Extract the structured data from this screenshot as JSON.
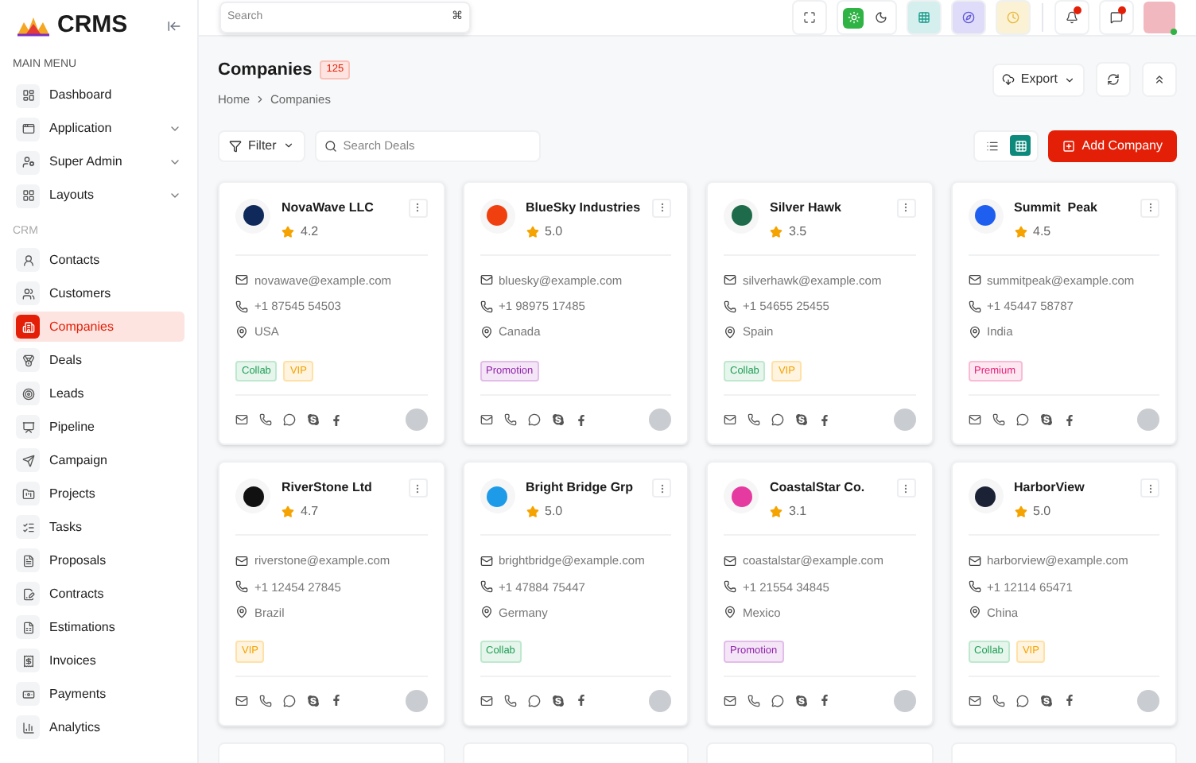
{
  "brand": {
    "name": "CRMS"
  },
  "sidebar": {
    "sections": [
      {
        "title": "MAIN MENU",
        "items": [
          {
            "label": "Dashboard",
            "selected": false
          },
          {
            "label": "Application",
            "selected": false,
            "expanded": false
          },
          {
            "label": "Super Admin",
            "selected": false,
            "expanded": false
          },
          {
            "label": "Layouts",
            "selected": false,
            "expanded": false
          }
        ]
      },
      {
        "title": "CRM",
        "items": [
          {
            "label": "Contacts",
            "selected": false
          },
          {
            "label": "Customers",
            "selected": false
          },
          {
            "label": "Companies",
            "selected": true
          },
          {
            "label": "Deals",
            "selected": false
          },
          {
            "label": "Leads",
            "selected": false
          },
          {
            "label": "Pipeline",
            "selected": false
          },
          {
            "label": "Campaign",
            "selected": false
          },
          {
            "label": "Projects",
            "selected": false
          },
          {
            "label": "Tasks",
            "selected": false
          },
          {
            "label": "Proposals",
            "selected": false
          },
          {
            "label": "Contracts",
            "selected": false
          },
          {
            "label": "Estimations",
            "selected": false
          },
          {
            "label": "Invoices",
            "selected": false
          },
          {
            "label": "Payments",
            "selected": false
          },
          {
            "label": "Analytics",
            "selected": false
          }
        ]
      }
    ]
  },
  "topbar": {
    "search": {
      "placeholder": "Search",
      "shortcut": "⌘"
    },
    "theme": [
      {
        "kind": "light",
        "selected": true
      },
      {
        "kind": "dark",
        "selected": false
      }
    ],
    "notifications": [
      {
        "kind": "bell",
        "unread": true
      },
      {
        "kind": "chat",
        "unread": true
      }
    ],
    "user": {
      "online": true
    }
  },
  "page": {
    "title": "Companies",
    "count": "125",
    "breadcrumb": [
      "Home",
      "Companies"
    ],
    "export": "Export",
    "filter": "Filter",
    "search": {
      "placeholder": "Search Deals"
    },
    "views": [
      {
        "kind": "list",
        "selected": false
      },
      {
        "kind": "grid",
        "selected": true
      }
    ],
    "add_button": "Add Company"
  },
  "cards": [
    {
      "name": "NovaWave LLC",
      "rating": "4.2",
      "email": "novawave@example.com",
      "phone": "+1 87545 54503",
      "location": "USA",
      "tags": [
        {
          "label": "Collab",
          "kind": "collab"
        },
        {
          "label": "VIP",
          "kind": "vip"
        }
      ]
    },
    {
      "name": "BlueSky Industries",
      "rating": "5.0",
      "email": "bluesky@example.com",
      "phone": "+1 98975 17485",
      "location": "Canada",
      "tags": [
        {
          "label": "Promotion",
          "kind": "promotion"
        }
      ]
    },
    {
      "name": "Silver Hawk",
      "rating": "3.5",
      "email": "silverhawk@example.com",
      "phone": "+1 54655 25455",
      "location": "Spain",
      "tags": [
        {
          "label": "Collab",
          "kind": "collab"
        },
        {
          "label": "VIP",
          "kind": "vip"
        }
      ]
    },
    {
      "name": "Summit  Peak",
      "rating": "4.5",
      "email": "summitpeak@example.com",
      "phone": "+1 45447 58787",
      "location": "India",
      "tags": [
        {
          "label": "Premium",
          "kind": "premium"
        }
      ]
    },
    {
      "name": "RiverStone Ltd",
      "rating": "4.7",
      "email": "riverstone@example.com",
      "phone": "+1 12454 27845",
      "location": "Brazil",
      "tags": [
        {
          "label": "VIP",
          "kind": "vip"
        }
      ]
    },
    {
      "name": "Bright Bridge Grp",
      "rating": "5.0",
      "email": "brightbridge@example.com",
      "phone": "+1 47884 75447",
      "location": "Germany",
      "tags": [
        {
          "label": "Collab",
          "kind": "collab"
        }
      ]
    },
    {
      "name": "CoastalStar Co.",
      "rating": "3.1",
      "email": "coastalstar@example.com",
      "phone": "+1 21554 34845",
      "location": "Mexico",
      "tags": [
        {
          "label": "Promotion",
          "kind": "promotion"
        }
      ]
    },
    {
      "name": "HarborView",
      "rating": "5.0",
      "email": "harborview@example.com",
      "phone": "+1 12114 65471",
      "location": "China",
      "tags": [
        {
          "label": "Collab",
          "kind": "collab"
        },
        {
          "label": "VIP",
          "kind": "vip"
        }
      ]
    }
  ],
  "more_cards": [
    {
      "kind": "partial"
    },
    {
      "kind": "partial"
    },
    {
      "kind": "partial"
    },
    {
      "kind": "partial"
    }
  ]
}
